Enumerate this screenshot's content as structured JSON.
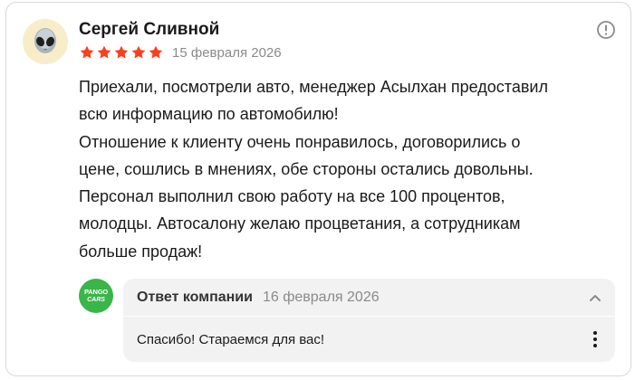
{
  "review": {
    "author": "Сергей Сливной",
    "rating": 5,
    "rating_max": 5,
    "date": "15 февраля 2026",
    "avatar_emoji": "👽",
    "text_lines": [
      "Приехали, посмотрели авто, менеджер Асылхан предоставил",
      "всю информацию по автомобилю!",
      "Отношение к клиенту очень понравилось, договорились о",
      "цене, сошлись в мнениях, обе стороны остались довольны.",
      "Персонал выполнил свою работу на все 100 процентов,",
      "молодцы. Автосалону желаю процветания, а сотрудникам",
      "больше продаж!"
    ]
  },
  "company_reply": {
    "logo_top": "PANGO",
    "logo_bottom": "CARS",
    "title": "Ответ компании",
    "date": "16 февраля 2026",
    "text": "Спасибо! Стараемся для вас!"
  },
  "colors": {
    "star": "#fc3f1d",
    "logo_bg": "#3ab54a",
    "reply_bg": "#f2f2f2",
    "muted_text": "#8a8a8a"
  },
  "icons": {
    "report": "alert-circle-icon",
    "collapse": "chevron-up-icon",
    "more": "more-vertical-icon"
  }
}
